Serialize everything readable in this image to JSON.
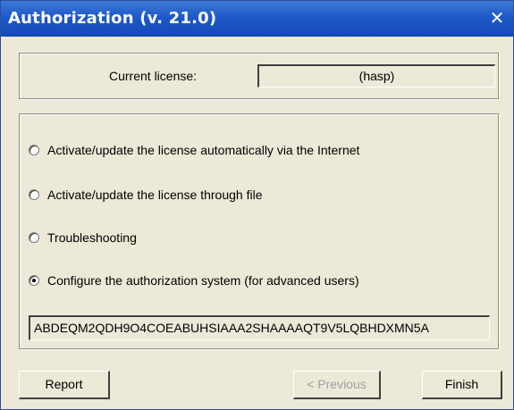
{
  "window": {
    "title": "Authorization (v. 21.0)",
    "close_glyph": "✕"
  },
  "license": {
    "label": "Current license:",
    "value": "(hasp)"
  },
  "options": [
    {
      "label": "Activate/update the license automatically via the Internet",
      "checked": false
    },
    {
      "label": "Activate/update the license through file",
      "checked": false
    },
    {
      "label": "Troubleshooting",
      "checked": false
    },
    {
      "label": "Configure the authorization system (for advanced users)",
      "checked": true
    }
  ],
  "key_field": {
    "value": "ABDEQM2QDH9O4COEABUHSIAAA2SHAAAAQT9V5LQBHDXMN5A"
  },
  "buttons": {
    "report": "Report",
    "previous": "< Previous",
    "finish": "Finish"
  },
  "colors": {
    "titlebar": "#1d59c9",
    "face": "#ece9d8"
  },
  "icons": {
    "close": "close-icon"
  }
}
